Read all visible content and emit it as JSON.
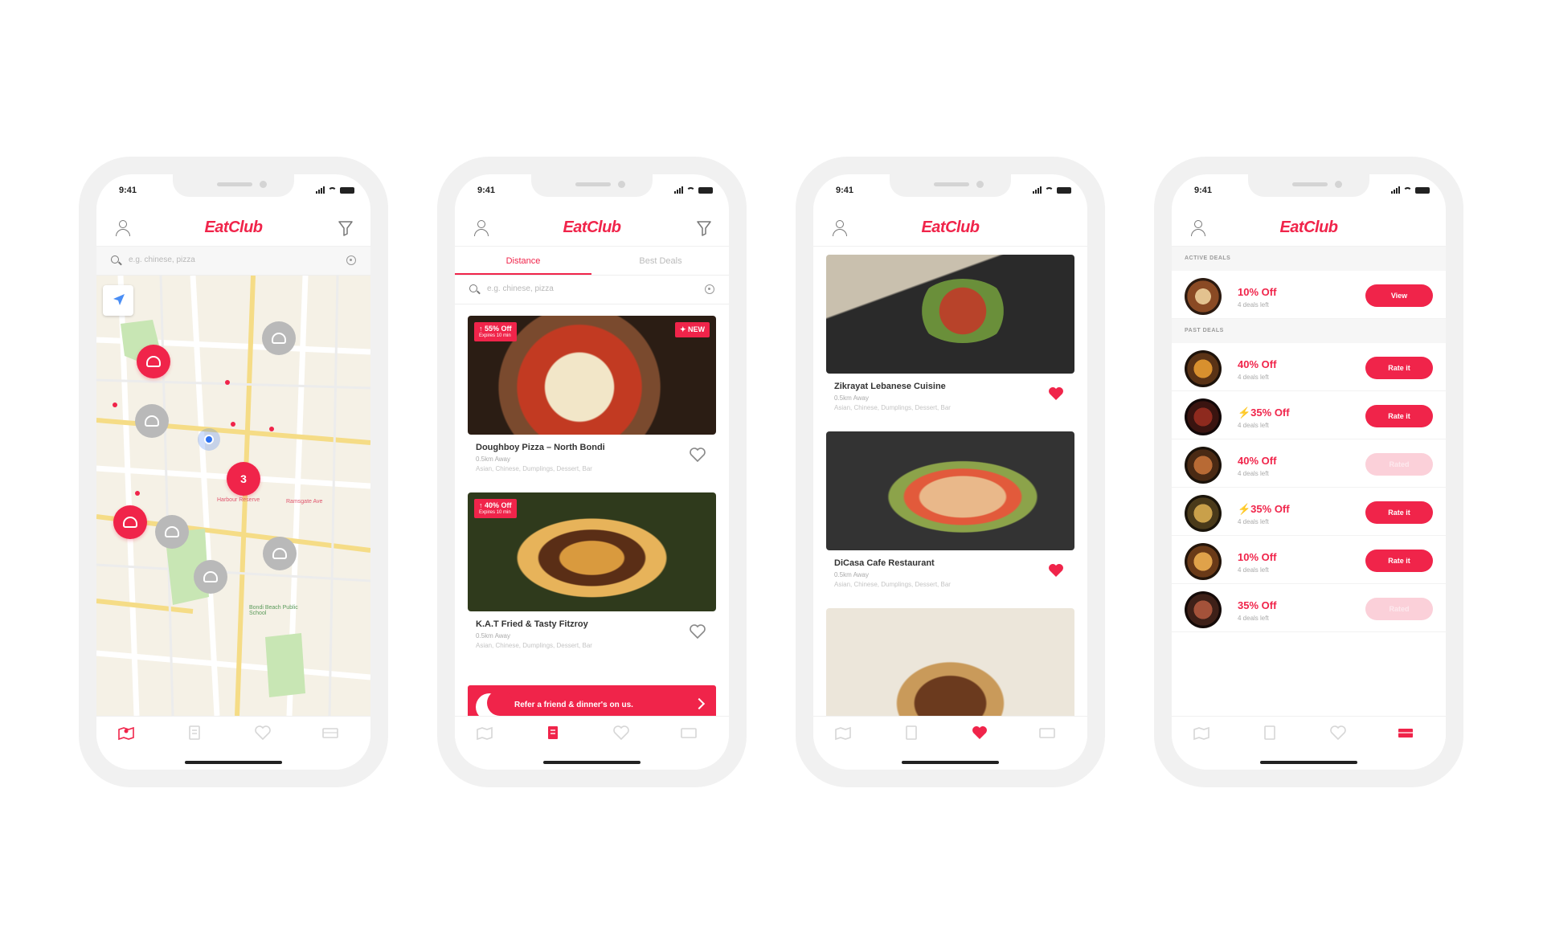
{
  "brand": {
    "logo_text": "EatClub",
    "accent": "#f0244a"
  },
  "status_bar": {
    "time": "9:41"
  },
  "search": {
    "placeholder": "e.g. chinese, pizza"
  },
  "screen_map": {
    "pins": [
      {
        "kind": "red",
        "label": ""
      },
      {
        "kind": "grey",
        "label": ""
      },
      {
        "kind": "grey",
        "label": ""
      },
      {
        "kind": "red",
        "label": "3"
      },
      {
        "kind": "red",
        "label": ""
      },
      {
        "kind": "grey",
        "label": ""
      },
      {
        "kind": "grey",
        "label": ""
      },
      {
        "kind": "grey",
        "label": ""
      }
    ],
    "map_labels": [
      "Harbour Reserve",
      "Ramsgate Ave",
      "Bondi Beach Public School"
    ]
  },
  "screen_list": {
    "tabs": [
      "Distance",
      "Best Deals"
    ],
    "active_tab": "Distance",
    "restaurants": [
      {
        "name": "Doughboy Pizza – North Bondi",
        "distance": "0.5km Away",
        "tags": "Asian, Chinese, Dumplings, Dessert, Bar",
        "deal": "↑ 55% Off",
        "deal_sub": "Expires 10 min",
        "new_badge": "✦ NEW",
        "favorited": false
      },
      {
        "name": "K.A.T Fried & Tasty Fitzroy",
        "distance": "0.5km Away",
        "tags": "Asian, Chinese, Dumplings, Dessert, Bar",
        "deal": "↑ 40% Off",
        "deal_sub": "Expires 10 min",
        "new_badge": "",
        "favorited": false
      }
    ],
    "refer_banner": "Refer a friend & dinner's on us."
  },
  "screen_favs": {
    "restaurants": [
      {
        "name": "Zikrayat Lebanese Cuisine",
        "distance": "0.5km Away",
        "tags": "Asian, Chinese, Dumplings, Dessert, Bar",
        "favorited": true
      },
      {
        "name": "DiCasa Cafe Restaurant",
        "distance": "0.5km Away",
        "tags": "Asian, Chinese, Dumplings, Dessert, Bar",
        "favorited": true
      }
    ]
  },
  "screen_deals": {
    "active_header": "ACTIVE DEALS",
    "past_header": "PAST DEALS",
    "active": [
      {
        "percent": "10% Off",
        "left": "4 deals left",
        "button": "View",
        "enabled": true
      }
    ],
    "past": [
      {
        "percent": "40% Off",
        "left": "4 deals left",
        "button": "Rate it",
        "enabled": true
      },
      {
        "percent": "⚡35% Off",
        "left": "4 deals left",
        "button": "Rate it",
        "enabled": true
      },
      {
        "percent": "40% Off",
        "left": "4 deals left",
        "button": "Rated",
        "enabled": false
      },
      {
        "percent": "⚡35% Off",
        "left": "4 deals left",
        "button": "Rate it",
        "enabled": true
      },
      {
        "percent": "10% Off",
        "left": "4 deals left",
        "button": "Rate it",
        "enabled": true
      },
      {
        "percent": "35% Off",
        "left": "4 deals left",
        "button": "Rated",
        "enabled": false
      }
    ]
  },
  "tab_icons": [
    "map-icon",
    "list-icon",
    "heart-icon",
    "ticket-icon"
  ]
}
